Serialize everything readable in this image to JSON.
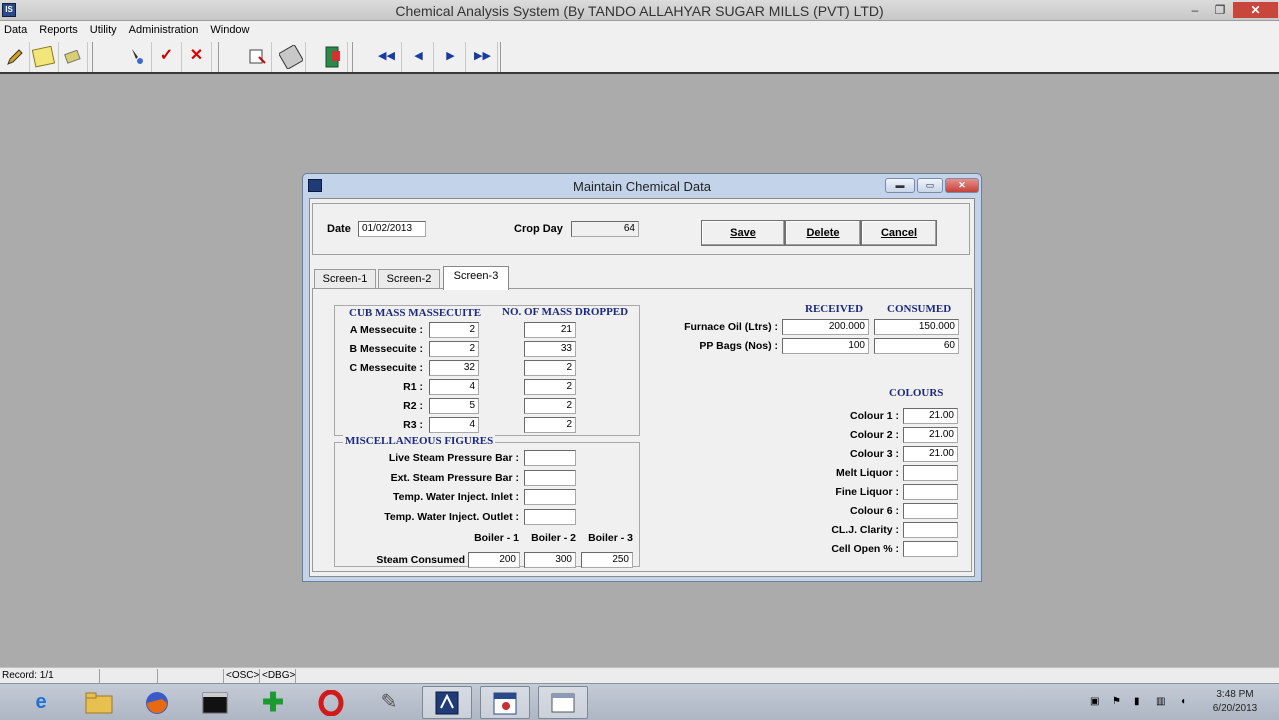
{
  "app": {
    "title": "Chemical Analysis System (By TANDO ALLAHYAR SUGAR MILLS (PVT) LTD)",
    "icon_text": "IS"
  },
  "menu": [
    "Data",
    "Reports",
    "Utility",
    "Administration",
    "Window"
  ],
  "toolbar_icons": [
    "pencil-icon",
    "notepad-icon",
    "eraser-icon",
    "find-icon",
    "checkmark-icon",
    "delete-x-icon",
    "print-icon",
    "disk-icon",
    "exit-door-icon",
    "first-record-icon",
    "previous-record-icon",
    "next-record-icon",
    "last-record-icon"
  ],
  "dialog": {
    "title": "Maintain Chemical Data",
    "date_label": "Date",
    "date_value": "01/02/2013",
    "crop_day_label": "Crop Day",
    "crop_day_value": "64",
    "buttons": {
      "save": "Save",
      "delete": "Delete",
      "cancel": "Cancel"
    },
    "tabs": [
      "Screen-1",
      "Screen-2",
      "Screen-3"
    ],
    "active_tab": "Screen-3"
  },
  "massecuite": {
    "caption_left": "CUB MASS MASSECUITE",
    "caption_right": "NO. OF MASS DROPPED",
    "rows": [
      {
        "label": "A Messecuite :",
        "cub": "2",
        "dropped": "21"
      },
      {
        "label": "B Messecuite :",
        "cub": "2",
        "dropped": "33"
      },
      {
        "label": "C Messecuite :",
        "cub": "32",
        "dropped": "2"
      },
      {
        "label": "R1 :",
        "cub": "4",
        "dropped": "2"
      },
      {
        "label": "R2 :",
        "cub": "5",
        "dropped": "2"
      },
      {
        "label": "R3 :",
        "cub": "4",
        "dropped": "2"
      }
    ]
  },
  "misc": {
    "caption": "MISCELLANEOUS FIGURES",
    "rows": [
      {
        "label": "Live Steam Pressure Bar :",
        "value": ""
      },
      {
        "label": "Ext. Steam Pressure Bar :",
        "value": ""
      },
      {
        "label": "Temp. Water Inject. Inlet :",
        "value": ""
      },
      {
        "label": "Temp. Water Inject. Outlet :",
        "value": ""
      }
    ],
    "boiler_headers": [
      "Boiler - 1",
      "Boiler - 2",
      "Boiler - 3"
    ],
    "steam_label": "Steam Consumed",
    "steam_values": [
      "200",
      "300",
      "250"
    ]
  },
  "fuel": {
    "received_header": "RECEIVED",
    "consumed_header": "CONSUMED",
    "rows": [
      {
        "label": "Furnace Oil (Ltrs) :",
        "received": "200.000",
        "consumed": "150.000"
      },
      {
        "label": "PP Bags (Nos) :",
        "received": "100",
        "consumed": "60"
      }
    ]
  },
  "colours": {
    "caption": "COLOURS",
    "rows": [
      {
        "label": "Colour 1 :",
        "value": "21.00"
      },
      {
        "label": "Colour 2 :",
        "value": "21.00"
      },
      {
        "label": "Colour 3 :",
        "value": "21.00"
      },
      {
        "label": "Melt Liquor :",
        "value": ""
      },
      {
        "label": "Fine Liquor :",
        "value": ""
      },
      {
        "label": "Colour 6 :",
        "value": ""
      },
      {
        "label": "CL.J. Clarity :",
        "value": ""
      },
      {
        "label": "Cell Open % :",
        "value": ""
      }
    ]
  },
  "statusbar": [
    "Record: 1/1",
    "",
    "",
    "<OSC>",
    "<DBG>"
  ],
  "taskbar": {
    "apps": [
      "internet-explorer-icon",
      "file-explorer-icon",
      "firefox-icon",
      "command-prompt-icon",
      "add-program-icon",
      "opera-icon",
      "tool-icon",
      "analysis-app-icon",
      "calendar-app-icon",
      "window-app-icon"
    ],
    "time": "3:48 PM",
    "date": "6/20/2013"
  }
}
